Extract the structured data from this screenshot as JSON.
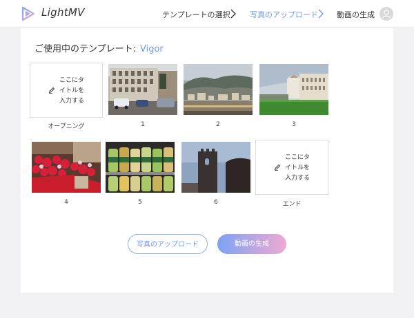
{
  "app": {
    "brand": "LightMV"
  },
  "header": {
    "steps": [
      {
        "label": "テンプレートの選択",
        "active": false
      },
      {
        "label": "写真のアップロード",
        "active": true
      },
      {
        "label": "動画の生成",
        "active": false
      }
    ]
  },
  "template": {
    "label": "ご使用中のテンプレート:",
    "name": "Vigor"
  },
  "slots": {
    "opening": {
      "placeholder": "ここにタ\nイトルを\n入力する",
      "caption": "オープニング"
    },
    "ending": {
      "placeholder": "ここにタ\nイトルを\n入力する",
      "caption": "エンド"
    },
    "photos": [
      {
        "caption": "1",
        "subject": "street-buildings-photo"
      },
      {
        "caption": "2",
        "subject": "coastal-town-photo"
      },
      {
        "caption": "3",
        "subject": "cathedral-lawn-photo"
      },
      {
        "caption": "4",
        "subject": "flower-shop-photo"
      },
      {
        "caption": "5",
        "subject": "bottles-shelf-photo"
      },
      {
        "caption": "6",
        "subject": "tower-photo"
      }
    ]
  },
  "actions": {
    "upload_label": "写真のアップロード",
    "generate_label": "動画の生成"
  },
  "colors": {
    "accent": "#6f9bf2",
    "gradient_start": "#7da3f3",
    "gradient_end": "#f0a9d2"
  },
  "icons": [
    "lightmv-logo-icon",
    "chevron-right-icon",
    "user-avatar-icon",
    "pencil-icon"
  ]
}
